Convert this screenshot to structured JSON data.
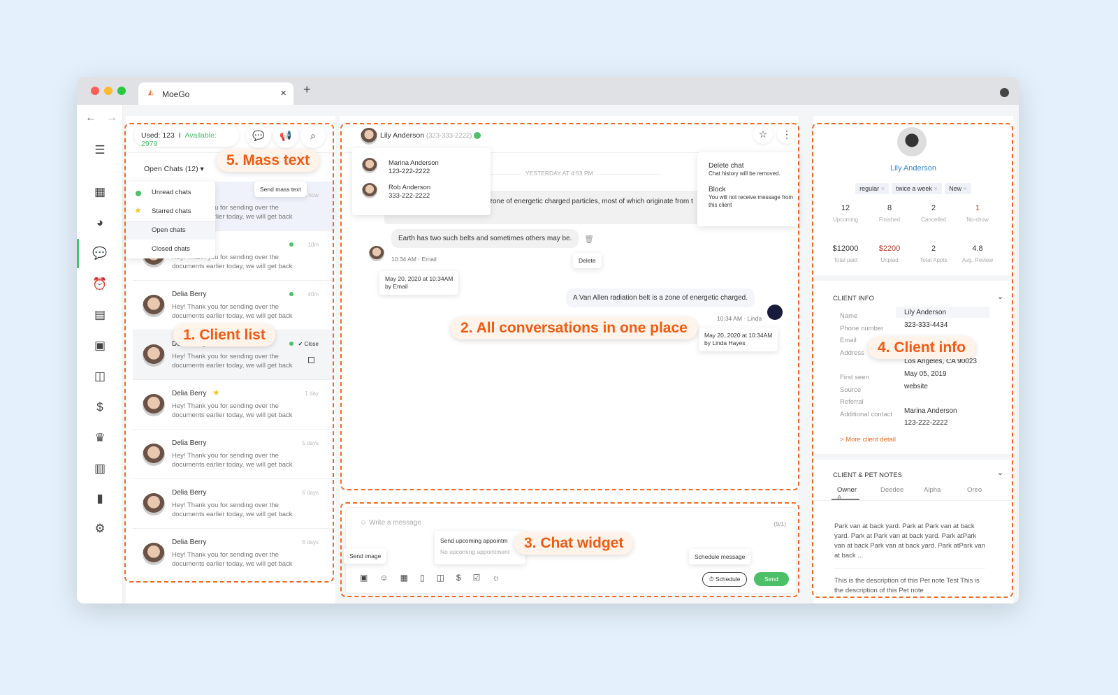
{
  "browser": {
    "tab_title": "MoeGo",
    "new_tab": "+",
    "close": "×"
  },
  "labels": {
    "client_list": "1. Client list",
    "conversations": "2. All conversations in one place",
    "chat_widget": "3. Chat widget",
    "client_info": "4. Client info",
    "mass_text": "5. Mass text"
  },
  "sidebar": {
    "items": [
      "menu-icon",
      "calendar-icon",
      "pet-icon",
      "chat-icon",
      "alarm-icon",
      "schedule-icon",
      "clipboard-icon",
      "notes-icon",
      "dollar-icon",
      "crown-icon",
      "report-icon",
      "chart-icon",
      "gear-icon"
    ],
    "active": "chat-icon",
    "accent": "#4cc068"
  },
  "chatlist": {
    "used": "Used: 123",
    "separator": "I",
    "available": "Available: 2979",
    "filter": "Open Chats (12) ▾",
    "mass_tooltip": "Send mass text",
    "filter_menu": [
      "Unread chats",
      "Starred chats",
      "Open chats",
      "Closed chats"
    ],
    "items": [
      {
        "name": "",
        "time": "Just now",
        "preview": "Hey! Thank you for sending over the documents earlier today, we will get back"
      },
      {
        "name": "",
        "time": "10m",
        "preview": "Hey! Thank you for sending over the documents earlier today, we will get back"
      },
      {
        "name": "Delia Berry",
        "time": "40m",
        "preview": "Hey! Thank you for sending over the documents earlier today, we will get back"
      },
      {
        "name": "Delia Berry",
        "time": "✔ Close",
        "preview": "Hey! Thank you for sending over the documents earlier today, we will get back"
      },
      {
        "name": "Delia Berry",
        "time": "1 day",
        "preview": "Hey! Thank you for sending over the documents earlier today, we will get back"
      },
      {
        "name": "Delia Berry",
        "time": "5 days",
        "preview": "Hey! Thank you for sending over the documents earlier today, we will get back"
      },
      {
        "name": "Delia Berry",
        "time": "6 days",
        "preview": "Hey! Thank you for sending over the documents earlier today, we will get back"
      },
      {
        "name": "Delia Berry",
        "time": "6 days",
        "preview": "Hey! Thank you for sending over the documents earlier today, we will get back"
      }
    ]
  },
  "chat": {
    "client": "Lily Anderson",
    "phone": "(323-333-2222)",
    "contacts": [
      {
        "name": "Marina Anderson",
        "phone": "123-222-2222"
      },
      {
        "name": "Rob Anderson",
        "phone": "333-222-2222"
      }
    ],
    "day_divider": "YESTERDAY AT 4:53 PM",
    "menu": [
      {
        "title": "Delete chat",
        "desc": "Chat history will be removed."
      },
      {
        "title": "Block",
        "desc": "You will not receive message from this client"
      }
    ],
    "messages": [
      {
        "text": "zone of energetic charged particles, most of which originate from t"
      },
      {
        "text": "Earth has two such belts and sometimes others may be.",
        "meta": "10:34 AM · Email",
        "tip": "May 20, 2020 at 10:34AM",
        "tip2": "by Email",
        "delete": "Delete"
      },
      {
        "text": "A Van Allen radiation belt is a zone of energetic charged.",
        "meta": "10:34 AM · Linda",
        "tip": "May 20, 2020 at 10:34AM",
        "tip2": "by Linda Hayes"
      }
    ]
  },
  "composer": {
    "placeholder": "Write a message",
    "counter": "(9/1)",
    "send_image": "Send image",
    "appt_title": "Send upcoming appointm",
    "appt_sub": "No upcoming appointment",
    "schedule_tip": "Schedule message",
    "schedule": "Schedule",
    "send": "Send"
  },
  "client": {
    "name": "Lily Anderson",
    "tags": [
      "regular",
      "twice a week",
      "New"
    ],
    "stats": [
      {
        "v": "12",
        "l": "Upcoming"
      },
      {
        "v": "8",
        "l": "Finished"
      },
      {
        "v": "2",
        "l": "Cancelled"
      },
      {
        "v": "1",
        "l": "No-show"
      },
      {
        "v": "$12000",
        "l": "Total paid"
      },
      {
        "v": "$2200",
        "l": "Unpiad"
      },
      {
        "v": "2",
        "l": "Total Appts"
      },
      {
        "v": "4.8",
        "l": "Avg. Review"
      }
    ],
    "info_title": "CLIENT INFO",
    "info": [
      {
        "k": "Name",
        "v": "Lily Anderson"
      },
      {
        "k": "Phone number",
        "v": "323-333-4434"
      },
      {
        "k": "Email",
        "v": ""
      },
      {
        "k": "Address",
        "v": "2"
      },
      {
        "k": "",
        "v": "Los Angeles, CA 90023"
      },
      {
        "k": "First seen",
        "v": "May 05, 2019"
      },
      {
        "k": "Source",
        "v": "website"
      },
      {
        "k": "Referral",
        "v": ""
      },
      {
        "k": "Additional contact",
        "v": "Marina Anderson"
      },
      {
        "k": "",
        "v": "123-222-2222"
      }
    ],
    "more": "> More client detail",
    "notes_title": "CLIENT & PET NOTES",
    "note_tabs": [
      "Owner",
      "Deedee",
      "Alpha",
      "Oreo",
      "A"
    ],
    "notes": [
      "Park van at back yard. Park at Park van at back yard. Park at Park van at back yard. Park atPark van at back Park van at back yard. Park atPark van at back ...",
      "This is the description of this Pet note Test This is the description of this Pet note"
    ],
    "red": "#c0392b",
    "link": "#3a86d8"
  }
}
